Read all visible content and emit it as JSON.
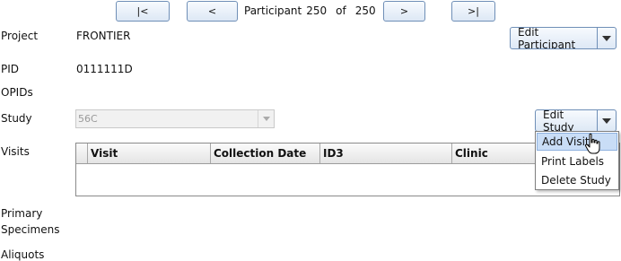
{
  "navigation": {
    "first_label": "|<",
    "prev_label": "<",
    "participant_word": "Participant",
    "current": "250",
    "of_word": "of",
    "total": "250",
    "next_label": ">",
    "last_label": ">|"
  },
  "fields": {
    "project_label": "Project",
    "project_value": "FRONTIER",
    "pid_label": "PID",
    "pid_value": "0111111D",
    "opids_label": "OPIDs",
    "study_label": "Study",
    "study_value": "56C",
    "visits_label": "Visits",
    "primary_label": "Primary",
    "specimens_label": "Specimens",
    "aliquots_label": "Aliquots"
  },
  "buttons": {
    "edit_participant": "Edit Participant",
    "edit_study": "Edit Study"
  },
  "visits_table": {
    "columns": [
      "Visit",
      "Collection Date",
      "ID3",
      "Clinic"
    ]
  },
  "study_menu": {
    "items": [
      "Add Visit",
      "Print Labels",
      "Delete Study"
    ],
    "hovered": "Add Visit"
  }
}
